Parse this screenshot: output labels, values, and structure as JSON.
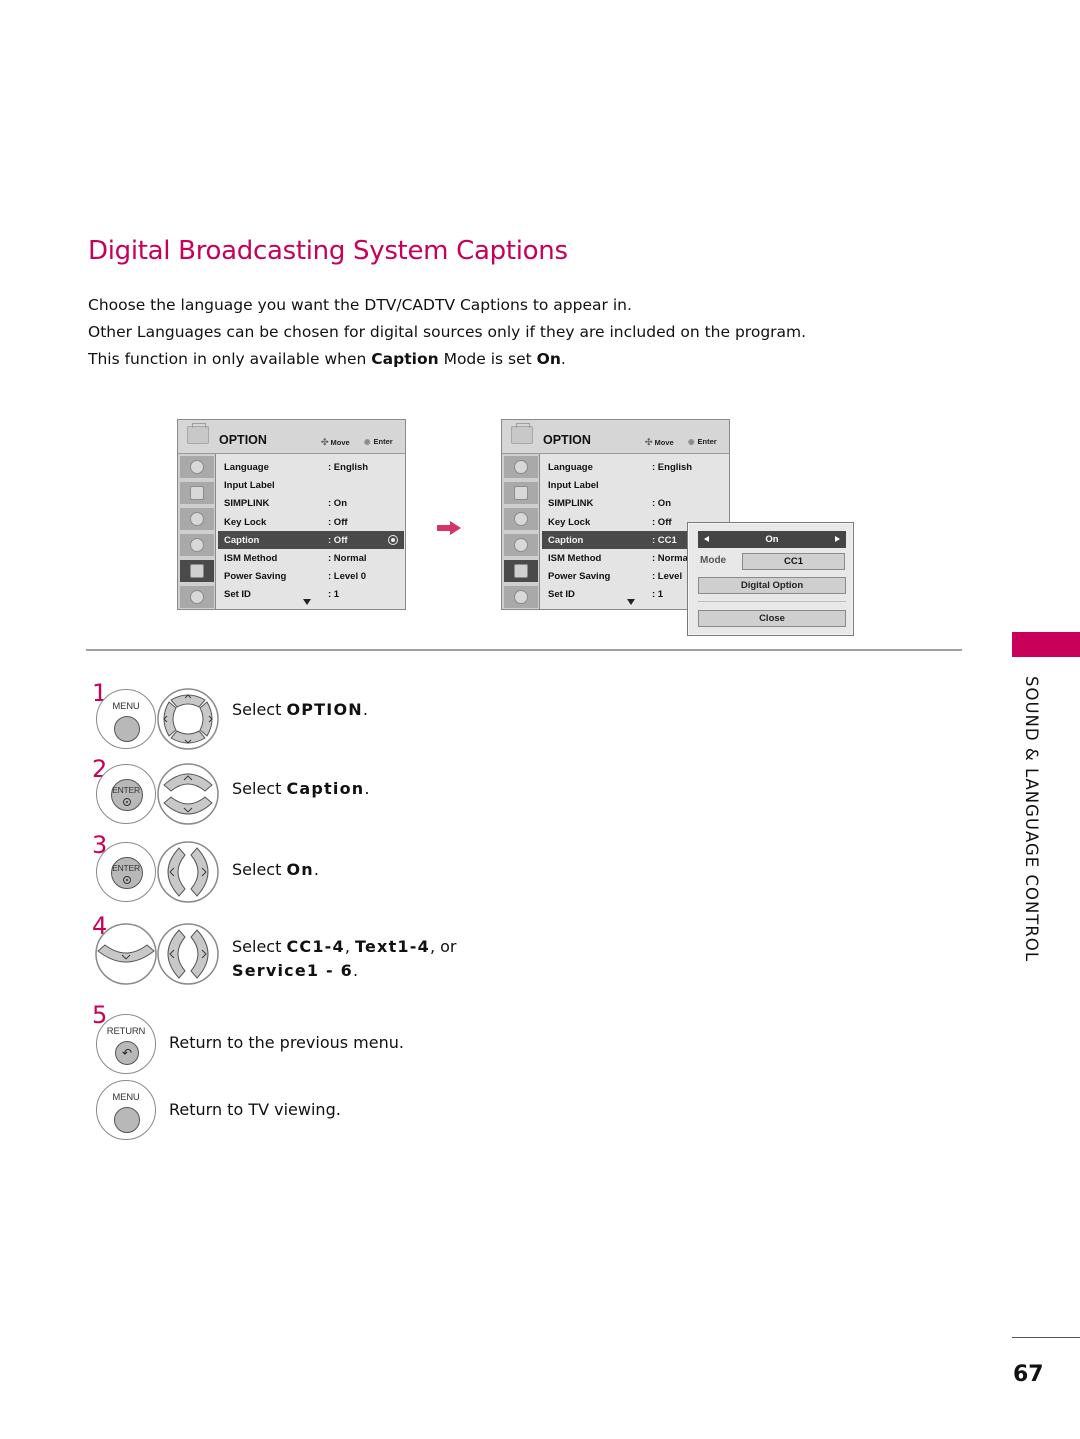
{
  "page": {
    "title": "Digital Broadcasting System Captions",
    "intro": [
      {
        "text": "Choose the language you want the DTV/CADTV Captions to appear in."
      },
      {
        "text": "Other Languages can be chosen for digital sources only if they are included on the program."
      },
      {
        "pre": "This function in only available when ",
        "b1": "Caption",
        "mid": " Mode is set ",
        "b2": "On",
        "post": "."
      }
    ],
    "section_tab": "SOUND & LANGUAGE CONTROL",
    "page_number": "67",
    "accent_color": "#c8005a"
  },
  "menu_left": {
    "header": "OPTION",
    "hint_move": "Move",
    "hint_enter": "Enter",
    "rows": [
      {
        "label": "Language",
        "value": ": English"
      },
      {
        "label": "Input Label",
        "value": ""
      },
      {
        "label": "SIMPLINK",
        "value": ": On"
      },
      {
        "label": "Key Lock",
        "value": ": Off"
      },
      {
        "label": "Caption",
        "value": ": Off"
      },
      {
        "label": "ISM Method",
        "value": ": Normal"
      },
      {
        "label": "Power Saving",
        "value": ": Level 0"
      },
      {
        "label": "Set ID",
        "value": ": 1"
      }
    ],
    "selected_row": "Caption"
  },
  "menu_right": {
    "header": "OPTION",
    "hint_move": "Move",
    "hint_enter": "Enter",
    "rows": [
      {
        "label": "Language",
        "value": ": English"
      },
      {
        "label": "Input Label",
        "value": ""
      },
      {
        "label": "SIMPLINK",
        "value": ": On"
      },
      {
        "label": "Key Lock",
        "value": ": Off"
      },
      {
        "label": "Caption",
        "value": ": CC1"
      },
      {
        "label": "ISM Method",
        "value": ": Norma"
      },
      {
        "label": "Power Saving",
        "value": ": Level"
      },
      {
        "label": "Set ID",
        "value": ": 1"
      }
    ],
    "selected_row": "Caption"
  },
  "popup": {
    "state": "On",
    "mode_label": "Mode",
    "mode_value": "CC1",
    "digital_option": "Digital Option",
    "close": "Close"
  },
  "steps": [
    {
      "num": "1",
      "buttons": [
        "MENU",
        "navigation-pad"
      ],
      "pre": "Select ",
      "bold": "OPTION",
      "post": "."
    },
    {
      "num": "2",
      "buttons": [
        "ENTER",
        "up-down"
      ],
      "pre": "Select ",
      "bold": "Caption",
      "post": "."
    },
    {
      "num": "3",
      "buttons": [
        "ENTER",
        "left-right"
      ],
      "pre": "Select ",
      "bold": "On",
      "post": "."
    },
    {
      "num": "4",
      "buttons": [
        "down",
        "left-right"
      ],
      "pre": "Select ",
      "bold": "CC1-4",
      "mid": ", ",
      "bold2": "Text1-4",
      "mid2": ", or",
      "bold3": "Service1 - 6",
      "post": "."
    },
    {
      "num": "5",
      "buttons": [
        "RETURN"
      ],
      "text": "Return to the previous menu."
    },
    {
      "num": "",
      "buttons": [
        "MENU"
      ],
      "text": "Return to TV viewing."
    }
  ],
  "button_labels": {
    "menu": "MENU",
    "enter": "ENTER",
    "return": "RETURN"
  }
}
